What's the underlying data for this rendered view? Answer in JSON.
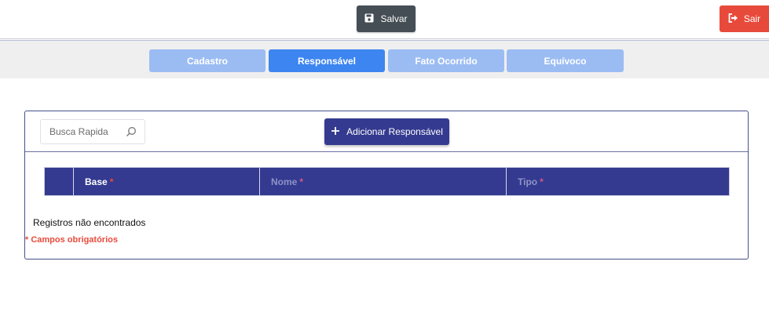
{
  "toolbar": {
    "save_label": "Salvar",
    "exit_label": "Sair"
  },
  "tabs": [
    {
      "label": "Cadastro",
      "active": false
    },
    {
      "label": "Responsável",
      "active": true
    },
    {
      "label": "Fato Ocorrido",
      "active": false
    },
    {
      "label": "Equívoco",
      "active": false
    }
  ],
  "panel": {
    "search_placeholder": "Busca Rapida",
    "add_button_label": "Adicionar Responsável",
    "columns": [
      {
        "label": "Base",
        "required_mark": "*"
      },
      {
        "label": "Nome",
        "required_mark": "*"
      },
      {
        "label": "Tipo",
        "required_mark": "*"
      }
    ],
    "empty_message": "Registros não encontrados",
    "required_note": "* Campos obrigatórios"
  },
  "colors": {
    "primary": "#343a8f",
    "tab_active": "#3d85f0",
    "tab_inactive": "#9bbcf3",
    "danger": "#e74a3b",
    "dark": "#454d55"
  },
  "icons": {
    "save": "floppy-disk-icon",
    "exit": "sign-out-icon",
    "search": "magnifier-icon",
    "add": "plus-icon"
  }
}
